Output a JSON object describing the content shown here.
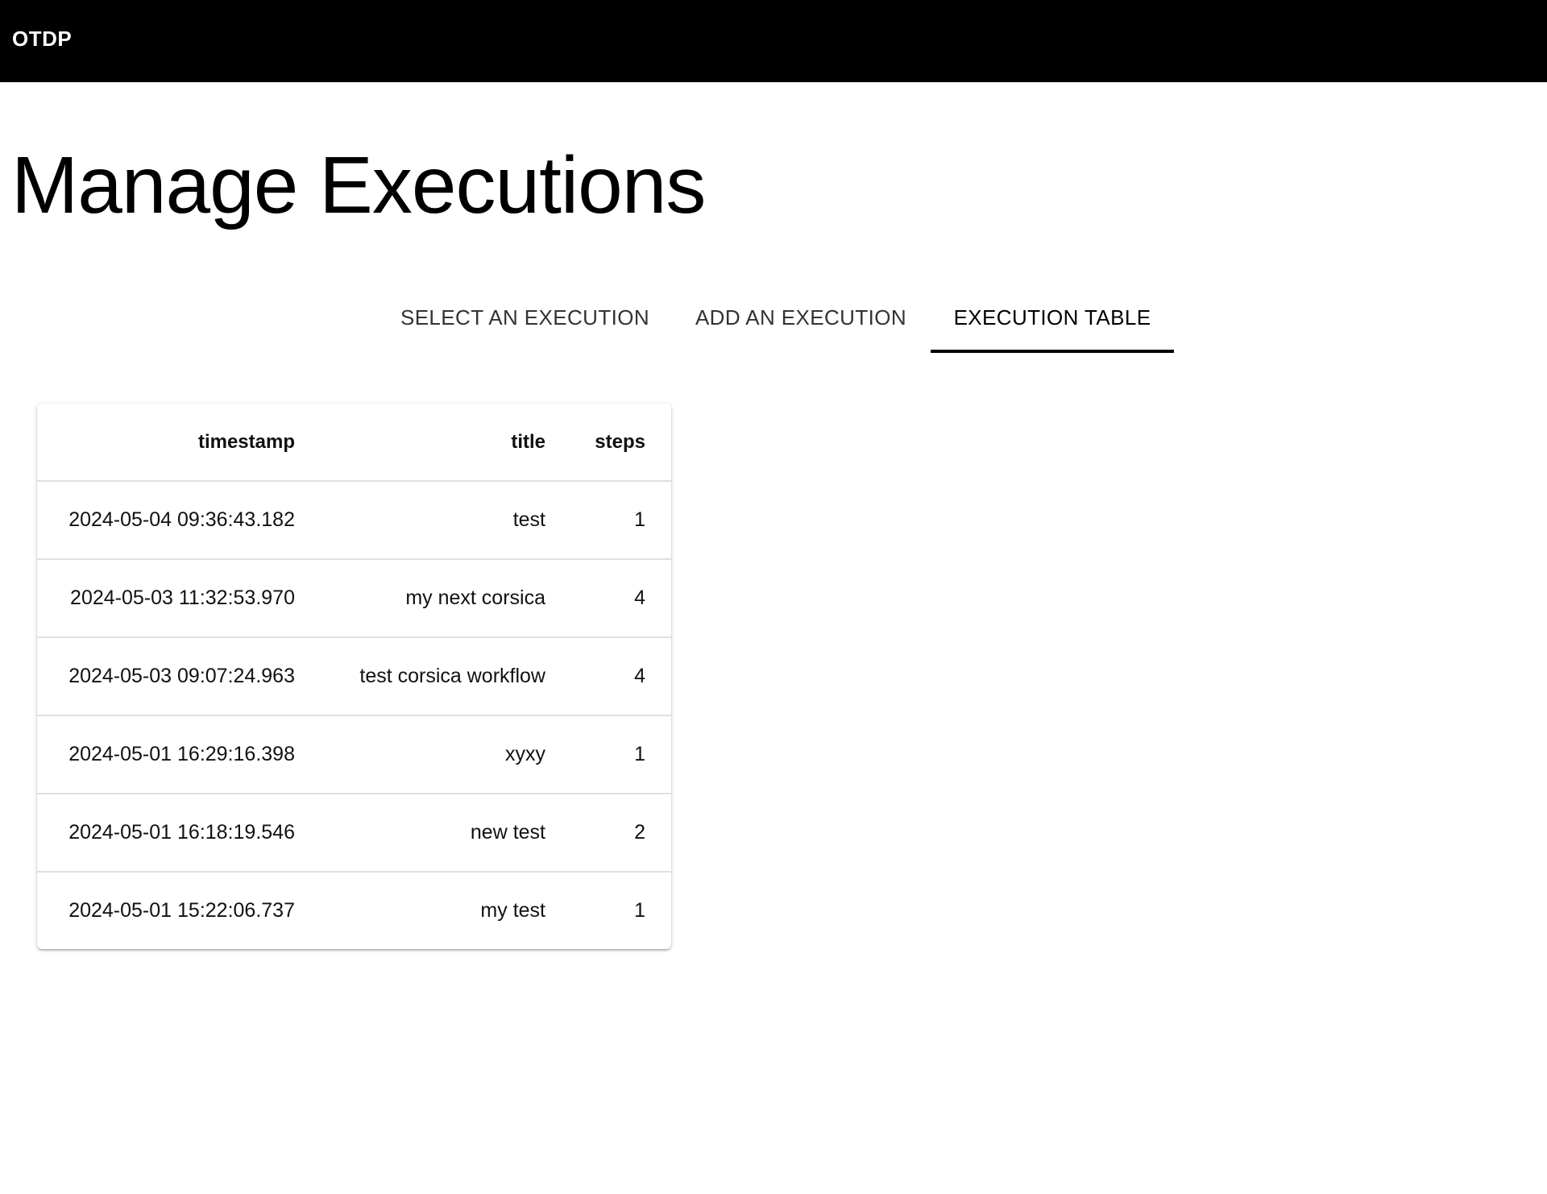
{
  "appbar": {
    "brand": "OTDP"
  },
  "page": {
    "title": "Manage Executions"
  },
  "tabs": [
    {
      "label": "SELECT AN EXECUTION",
      "selected": false
    },
    {
      "label": "ADD AN EXECUTION",
      "selected": false
    },
    {
      "label": "EXECUTION TABLE",
      "selected": true
    }
  ],
  "table": {
    "headers": {
      "timestamp": "timestamp",
      "title": "title",
      "steps": "steps"
    },
    "rows": [
      {
        "timestamp": "2024-05-04 09:36:43.182",
        "title": "test",
        "steps": "1"
      },
      {
        "timestamp": "2024-05-03 11:32:53.970",
        "title": "my next corsica",
        "steps": "4"
      },
      {
        "timestamp": "2024-05-03 09:07:24.963",
        "title": "test corsica workflow",
        "steps": "4"
      },
      {
        "timestamp": "2024-05-01 16:29:16.398",
        "title": "xyxy",
        "steps": "1"
      },
      {
        "timestamp": "2024-05-01 16:18:19.546",
        "title": "new test",
        "steps": "2"
      },
      {
        "timestamp": "2024-05-01 15:22:06.737",
        "title": "my test",
        "steps": "1"
      }
    ]
  }
}
